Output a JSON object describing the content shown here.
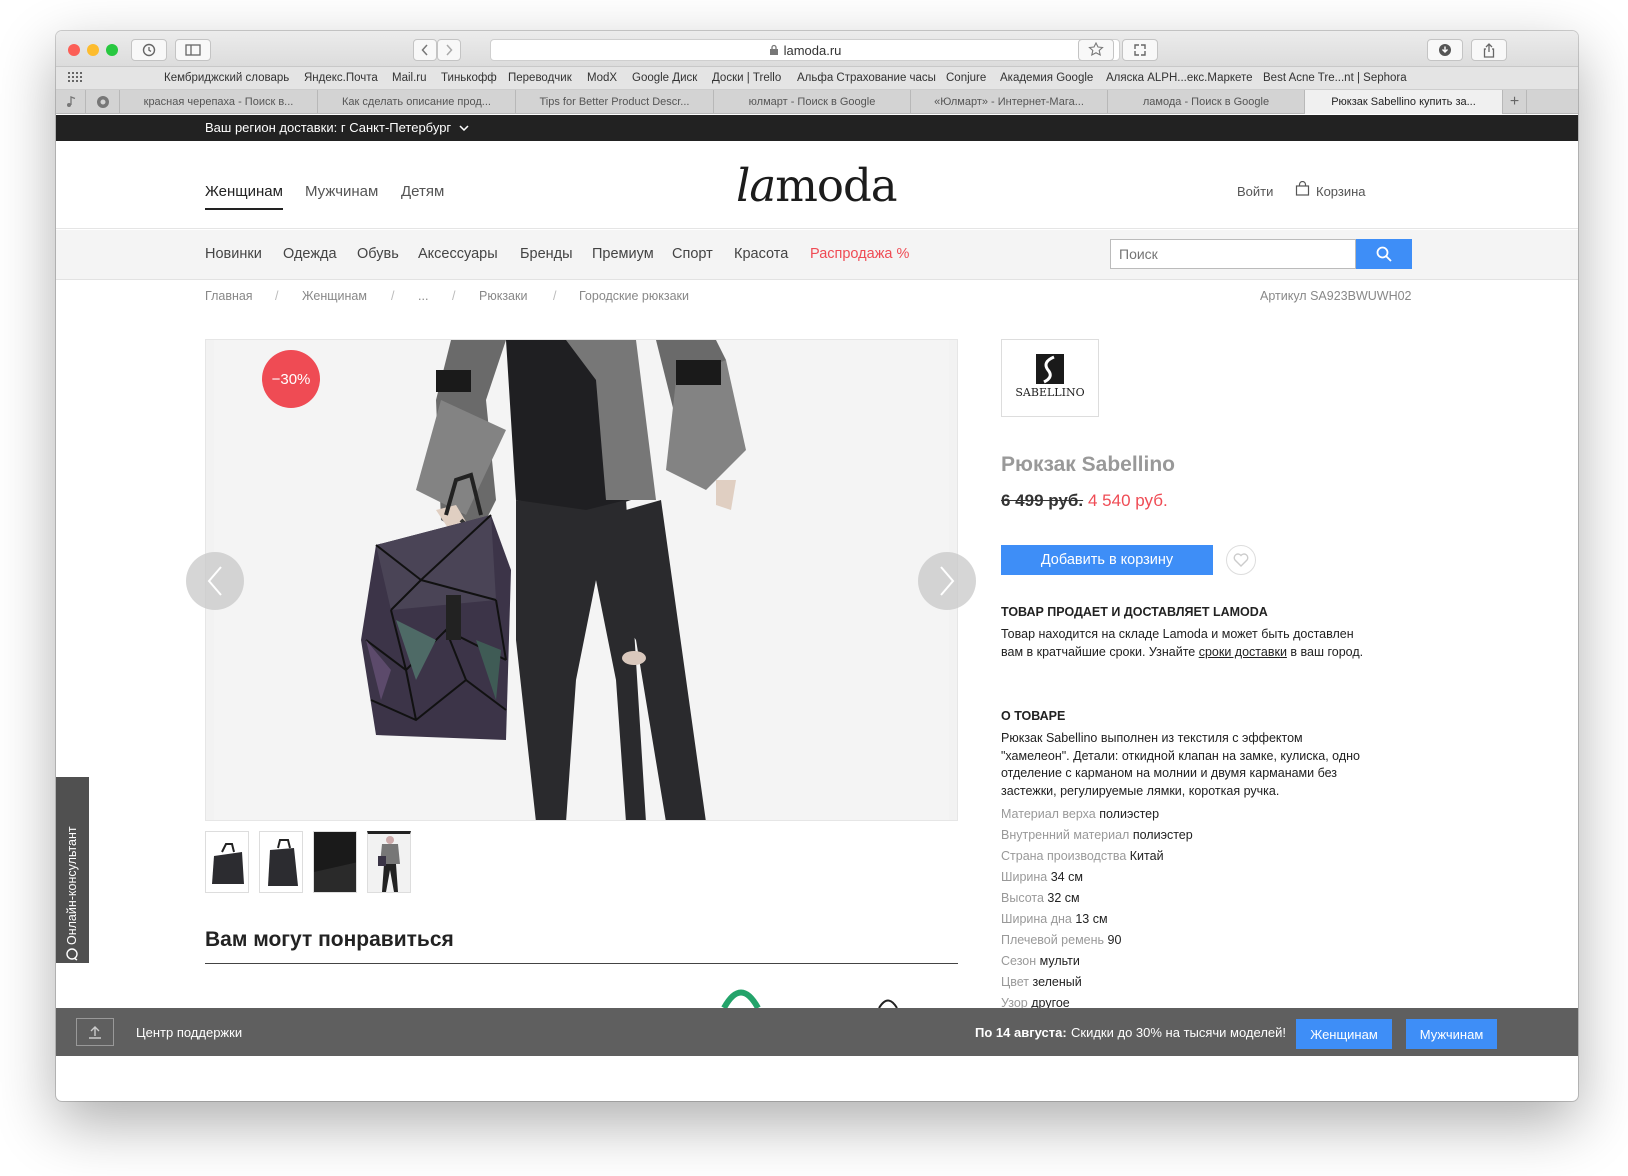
{
  "browser": {
    "url": "lamoda.ru",
    "bookmarks": [
      "Кембриджский словарь",
      "Яндекс.Почта",
      "Mail.ru",
      "Тинькофф",
      "Переводчик",
      "ModX",
      "Google Диск",
      "Доски | Trello",
      "Альфа Страхование часы",
      "Conjure",
      "Академия Google",
      "Аляска ALPH...екс.Маркете",
      "Best Acne Tre...nt | Sephora"
    ],
    "tabs": [
      "красная черепаха - Поиск в...",
      "Как сделать описание прод...",
      "Tips for Better Product Descr...",
      "юлмарт - Поиск в Google",
      "«Юлмарт» - Интернет-Мага...",
      "ламода - Поиск в Google",
      "Рюкзак Sabellino купить за..."
    ],
    "active_tab": 6
  },
  "region": {
    "label": "Ваш регион доставки: г Санкт-Петербург"
  },
  "header": {
    "gender_nav": [
      "Женщинам",
      "Мужчинам",
      "Детям"
    ],
    "logo_italic": "la",
    "logo_rest": "moda",
    "login": "Войти",
    "cart": "Корзина"
  },
  "categories": [
    "Новинки",
    "Одежда",
    "Обувь",
    "Аксессуары",
    "Бренды",
    "Премиум",
    "Спорт",
    "Красота",
    "Распродажа %"
  ],
  "search": {
    "placeholder": "Поиск"
  },
  "breadcrumb": [
    "Главная",
    "Женщинам",
    "...",
    "Рюкзаки",
    "Городские рюкзаки"
  ],
  "article": "Артикул SA923BWUWH02",
  "product": {
    "discount_badge": "−30%",
    "brand_logo_text": "SABELLINO",
    "title": "Рюкзак Sabellino",
    "old_price": "6 499 руб.",
    "new_price": "4 540 руб.",
    "add_to_cart": "Добавить в корзину",
    "seller_heading": "ТОВАР ПРОДАЕТ И ДОСТАВЛЯЕТ LAMODA",
    "seller_text_1": "Товар находится на складе Lamoda и может быть доставлен вам в кратчайшие сроки. Узнайте ",
    "seller_link": "сроки доставки",
    "seller_text_2": " в ваш город.",
    "about_heading": "О ТОВАРЕ",
    "about_text": "Рюкзак Sabellino выполнен из текстиля с эффектом \"хамелеон\". Детали: откидной клапан на замке, кулиска, одно отделение с карманом на молнии и двумя карманами без застежки, регулируемые лямки, короткая ручка.",
    "attributes": [
      {
        "label": "Материал верха",
        "value": "полиэстер"
      },
      {
        "label": "Внутренний материал",
        "value": "полиэстер"
      },
      {
        "label": "Страна производства",
        "value": "Китай"
      },
      {
        "label": "Ширина",
        "value": "34 см"
      },
      {
        "label": "Высота",
        "value": "32 см"
      },
      {
        "label": "Ширина дна",
        "value": "13 см"
      },
      {
        "label": "Плечевой ремень",
        "value": "90"
      },
      {
        "label": "Сезон",
        "value": "мульти"
      },
      {
        "label": "Цвет",
        "value": "зеленый"
      },
      {
        "label": "Узор",
        "value": "другое"
      }
    ]
  },
  "recommend": {
    "heading": "Вам могут понравиться"
  },
  "chat": {
    "label": "Онлайн-консультант"
  },
  "footer": {
    "support": "Центр поддержки",
    "promo_bold": "По 14 августа:",
    "promo_text": "Скидки до 30% на тысячи моделей!",
    "btn_women": "Женщинам",
    "btn_men": "Мужчинам"
  },
  "colors": {
    "accent": "#3e8ef7",
    "sale": "#ef4b54",
    "region_bar": "#222222",
    "footer_bar": "#5f5f5f"
  }
}
